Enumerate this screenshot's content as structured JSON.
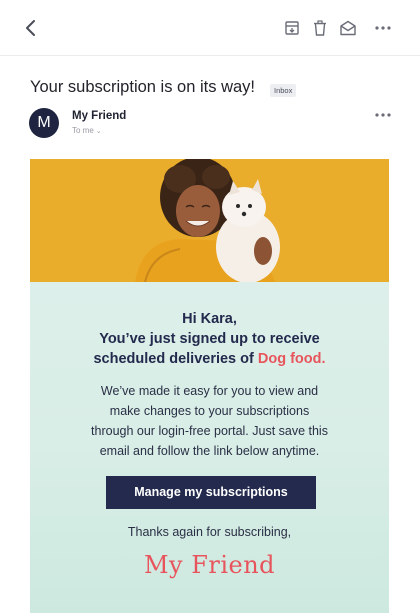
{
  "header": {
    "icons": [
      "back-icon",
      "archive-icon",
      "trash-icon",
      "mark-read-icon",
      "more-icon"
    ]
  },
  "message": {
    "subject": "Your subscription is on its way!",
    "label": "Inbox",
    "avatar_letter": "M",
    "sender": "My Friend",
    "recipient": "To me"
  },
  "email": {
    "greeting_line1": "Hi Kara,",
    "greeting_line2": "You’ve just signed up to receive",
    "greeting_line3_prefix": "scheduled deliveries of",
    "greeting_product": "Dog food.",
    "body_line1": "We’ve made it easy for you to view and",
    "body_line2": "make changes to your subscriptions",
    "body_line3": "through our login-free portal. Just save this",
    "body_line4": "email and follow the link below anytime.",
    "cta_label": "Manage my subscriptions",
    "thanks": "Thanks again for subscribing,",
    "signoff": "My Friend"
  },
  "colors": {
    "accent": "#e8545c",
    "navy": "#232a4d",
    "mint": "#d9eee7",
    "hero_yellow": "#e6a624"
  }
}
